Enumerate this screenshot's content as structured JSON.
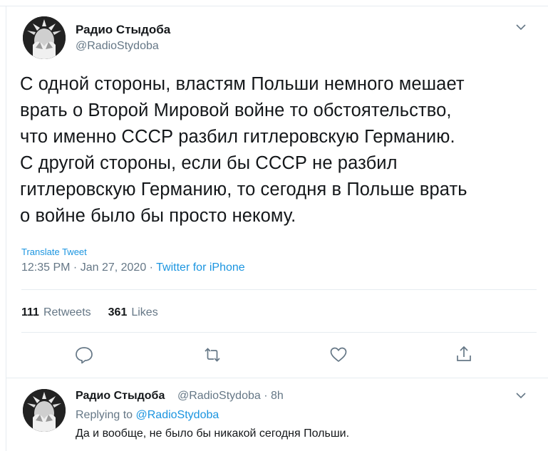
{
  "tweet": {
    "author_name": "Радио Стыдоба",
    "author_handle": "@RadioStydoba",
    "text_lines": [
      "С одной стороны, властям Польши немного мешает",
      "врать о Второй Мировой войне то обстоятельство,",
      "что именно СССР разбил гитлеровскую Германию.",
      "С другой стороны, если бы СССР не разбил",
      "гитлеровскую Германию, то сегодня в Польше врать",
      "о войне было бы просто некому."
    ],
    "translate_label": "Translate Tweet",
    "timestamp": "12:35 PM · Jan 27, 2020 · ",
    "source": "Twitter for iPhone",
    "retweets_count": "111",
    "retweets_label": "Retweets",
    "likes_count": "361",
    "likes_label": "Likes"
  },
  "actions": {
    "reply_icon": "speech-bubble-icon",
    "retweet_icon": "retweet-arrows-icon",
    "like_icon": "heart-icon",
    "share_icon": "share-upload-icon"
  },
  "reply": {
    "author_name": "Радио Стыдоба",
    "author_handle_time": "@RadioStydoba · 8h",
    "replying_prefix": "Replying to ",
    "replying_handle": "@RadioStydoba",
    "text": "Да и вообще, не было бы никакой сегодня Польши."
  },
  "colors": {
    "accent": "#1b95e0",
    "secondary_text": "#657786",
    "divider": "#e6ecf0"
  }
}
